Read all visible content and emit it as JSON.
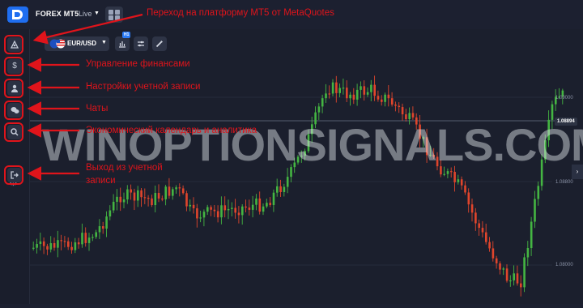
{
  "header": {
    "brand": "FOREX MT5",
    "account_mode": "Live",
    "logo_icon": "broker-logo-icon",
    "grid_icon": "grid-icon"
  },
  "toolbar": {
    "pair_label": "EUR/USD",
    "timeframe_badge": "H1",
    "buttons": [
      "chart-type-icon",
      "indicators-icon",
      "drawing-icon"
    ]
  },
  "sidebar": {
    "items": [
      {
        "name": "mt5-platform",
        "icon": "platform-icon"
      },
      {
        "name": "finance",
        "icon": "dollar-icon",
        "glyph": "$"
      },
      {
        "name": "account-settings",
        "icon": "user-icon"
      },
      {
        "name": "chats",
        "icon": "chat-icon"
      },
      {
        "name": "calendar-analytics",
        "icon": "search-icon"
      },
      {
        "name": "settings",
        "icon": "gear-icon"
      },
      {
        "name": "logout",
        "icon": "logout-icon"
      }
    ]
  },
  "annotations": {
    "mt5": "Переход на платформу MT5 от MetaQuotes",
    "finance": "Управление финансами",
    "account": "Настройки учетной записи",
    "chats": "Чаты",
    "calendar": "Экономический календарь и аналитика",
    "logout_line1": "Выход из учетной",
    "logout_line2": "записи"
  },
  "price_axis": {
    "current_price": "1.08894",
    "ticks": [
      "1.09000",
      "1.08800",
      "1.08000"
    ]
  },
  "watermark": "WINOPTIONSIGNALS.COM",
  "colors": {
    "bull": "#44b542",
    "bear": "#e0452c",
    "annotation": "#e0141b",
    "background": "#1b1f2d"
  },
  "chart_data": {
    "type": "candlestick",
    "title": "",
    "instrument": "EUR/USD",
    "timeframe": "H1",
    "current_price": 1.08894,
    "y_ticks": [
      1.09,
      1.088,
      1.08
    ]
  }
}
